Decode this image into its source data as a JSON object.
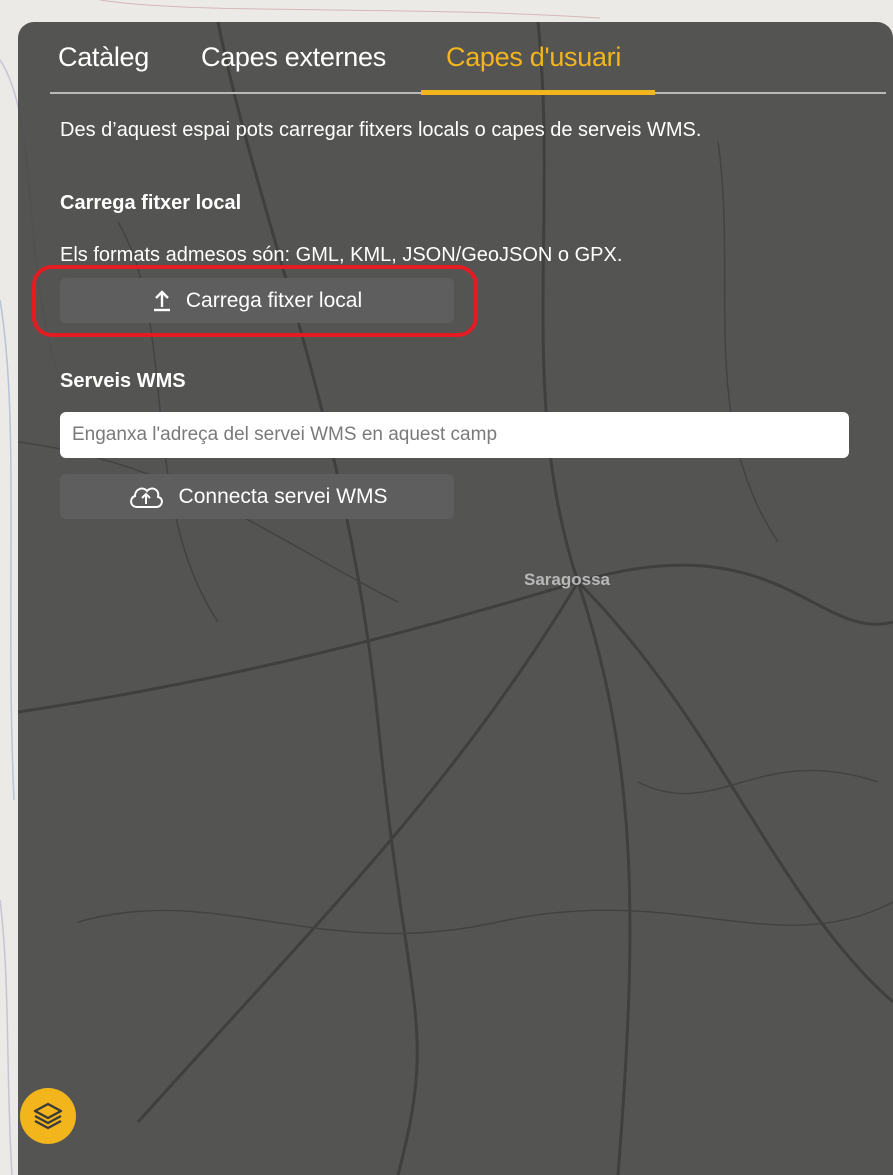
{
  "tabs": [
    {
      "label": "Catàleg"
    },
    {
      "label": "Capes externes"
    },
    {
      "label": "Capes d'usuari"
    }
  ],
  "colors": {
    "accent": "#f2b51c",
    "highlight": "#e31b23",
    "panel": "#464646"
  },
  "panel": {
    "description": "Des d’aquest espai pots carregar fitxers locals o capes de serveis WMS.",
    "local_file": {
      "heading": "Carrega fitxer local",
      "formats_text": "Els formats admesos són: GML, KML, JSON/GeoJSON o GPX.",
      "button_label": "Carrega fitxer local",
      "button_icon": "upload-icon"
    },
    "wms": {
      "heading": "Serveis WMS",
      "input_placeholder": "Enganxa l'adreça del servei WMS en aquest camp",
      "input_value": "",
      "button_label": "Connecta servei WMS",
      "button_icon": "cloud-upload-icon"
    }
  },
  "map": {
    "city_label": "Saragossa"
  },
  "layers_button": {
    "icon": "layers-icon"
  }
}
